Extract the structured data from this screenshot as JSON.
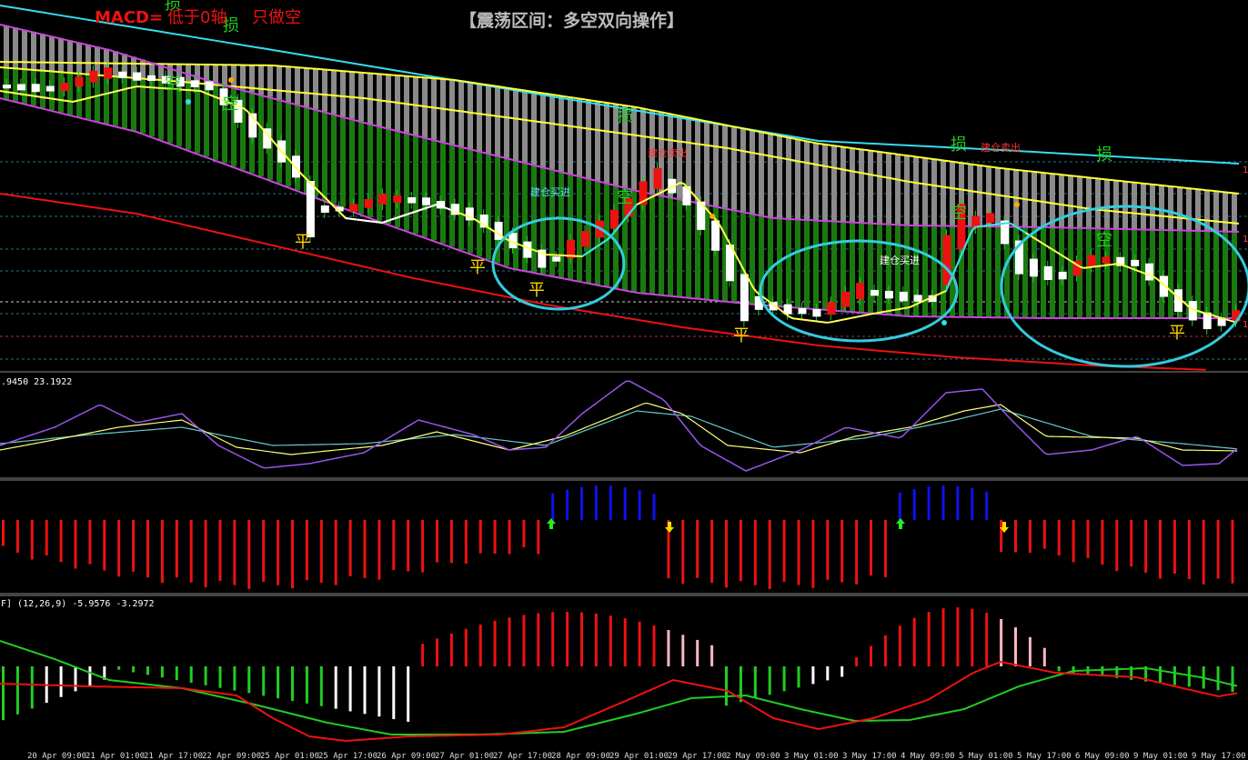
{
  "header": {
    "title_main": "【震荡区间：多空双向操作】",
    "macd_rule": "MACD=",
    "macd_rule_suffix": "低于0轴",
    "macd_rule_action": "只做空"
  },
  "panels": {
    "main": {
      "annotations": [
        {
          "text": "损",
          "color": "#22cc22"
        },
        {
          "text": "损",
          "color": "#22cc22"
        },
        {
          "text": "空",
          "color": "#22cc22"
        },
        {
          "text": "空",
          "color": "#22cc22"
        },
        {
          "text": "平",
          "color": "#ffd700"
        },
        {
          "text": "平",
          "color": "#ffd700"
        },
        {
          "text": "平",
          "color": "#ffd700"
        },
        {
          "text": "建仓买进",
          "color": "#66e0ff"
        },
        {
          "text": "空",
          "color": "#22cc22"
        },
        {
          "text": "损",
          "color": "#22cc22"
        },
        {
          "text": "建仓卖出",
          "color": "#ff3333"
        },
        {
          "text": "平",
          "color": "#ffd700"
        },
        {
          "text": "建仓买进",
          "color": "#ffffff"
        },
        {
          "text": "损",
          "color": "#22cc22"
        },
        {
          "text": "建仓卖出",
          "color": "#ff3333"
        },
        {
          "text": "空",
          "color": "#22cc22"
        },
        {
          "text": "损",
          "color": "#22cc22"
        },
        {
          "text": "空",
          "color": "#22cc22"
        },
        {
          "text": "平",
          "color": "#ffd700"
        }
      ],
      "right_ticks": [
        "1",
        "1",
        "1"
      ]
    },
    "osc": {
      "label": ".9450 23.1922"
    },
    "macd": {
      "label": "F] (12,26,9) -5.9576 -3.2972"
    }
  },
  "chart_data": {
    "type": "candlestick",
    "x_axis": [
      "20 Apr 09:00",
      "21 Apr 01:00",
      "21 Apr 17:00",
      "22 Apr 09:00",
      "25 Apr 01:00",
      "25 Apr 17:00",
      "26 Apr 09:00",
      "27 Apr 01:00",
      "27 Apr 17:00",
      "28 Apr 09:00",
      "29 Apr 01:00",
      "29 Apr 17:00",
      "2 May 09:00",
      "3 May 01:00",
      "3 May 17:00",
      "4 May 09:00",
      "5 May 01:00",
      "5 May 17:00",
      "6 May 09:00",
      "9 May 01:00",
      "9 May 17:00"
    ],
    "osc_series": [
      "purple",
      "yellow",
      "cyan"
    ],
    "histogram_a_colors": {
      "up": "#1010ee",
      "down": "#ee1111"
    },
    "histogram_b_colors": {
      "up": "#ee1111",
      "up_weak": "#ffb6c1",
      "down": "#22cc22",
      "down_weak": "#ffffff"
    },
    "macd_lines": {
      "fast": "#ee1111",
      "slow": "#22cc22"
    }
  },
  "colors": {
    "bull": "#ee1111",
    "bear": "#ffffff",
    "band_fill_green": "#1a7a10",
    "band_fill_gray": "#8a8a8a",
    "magenta": "#cc44dd",
    "yellow": "#ffff33",
    "cyan": "#33ddee",
    "red_ma": "#ee1111",
    "ellipse": "#33ccdd"
  }
}
